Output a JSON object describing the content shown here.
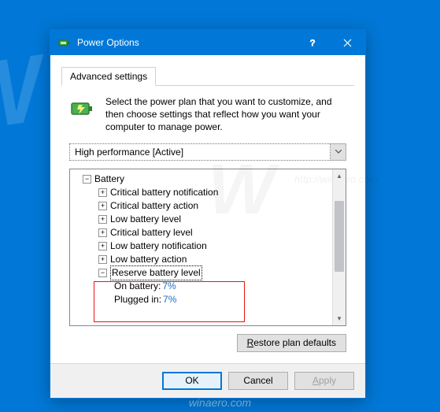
{
  "window": {
    "title": "Power Options"
  },
  "tabs": {
    "advanced": "Advanced settings"
  },
  "description": "Select the power plan that you want to customize, and then choose settings that reflect how you want your computer to manage power.",
  "plan": {
    "selected": "High performance [Active]"
  },
  "tree": {
    "root": "Battery",
    "items": [
      "Critical battery notification",
      "Critical battery action",
      "Low battery level",
      "Critical battery level",
      "Low battery notification",
      "Low battery action"
    ],
    "reserve": {
      "label": "Reserve battery level",
      "on_battery_label": "On battery:",
      "on_battery_value": "7%",
      "plugged_in_label": "Plugged in:",
      "plugged_in_value": "7%"
    }
  },
  "buttons": {
    "restore_pre": "R",
    "restore_post": "estore plan defaults",
    "ok": "OK",
    "cancel": "Cancel",
    "apply_pre": "A",
    "apply_post": "pply"
  },
  "watermark": {
    "big": "W",
    "url": "http://winaero.com",
    "footer": "winaero.com"
  }
}
